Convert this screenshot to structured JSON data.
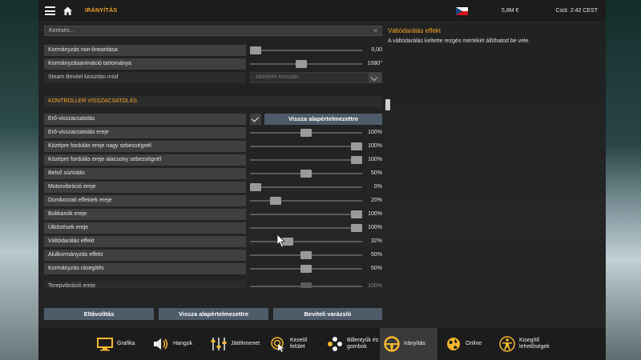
{
  "topbar": {
    "breadcrumb": "IRÁNYÍTÁS",
    "money": "5,8M  €",
    "clock": "Csüt. 2:42 CEST"
  },
  "search": {
    "placeholder": "Keresés..."
  },
  "settings": {
    "rows_top": [
      {
        "label": "Kormányzás non-linearitása",
        "value": "0,00",
        "level": 0.0
      },
      {
        "label": "Kormányzásanimáció tartománya",
        "value": "1080°",
        "level": 0.45
      }
    ],
    "steam": {
      "label": "Steam Bevitel kiosztási mód",
      "value": "Játékbeli kiosztás"
    },
    "section_title": "KONTROLLER VISSZACSATOLÁS",
    "ffb": {
      "label": "Erő-visszacsatolás",
      "checked": true,
      "reset_label": "Vissza alapértelmezettre"
    },
    "rows": [
      {
        "label": "Erő-visszacsatolás ereje",
        "value": "100%",
        "level": 0.5
      },
      {
        "label": "Középre fordulás ereje nagy sebességnél",
        "value": "100%",
        "level": 1.0
      },
      {
        "label": "Középre fordulás ereje alacsony sebességnél",
        "value": "100%",
        "level": 1.0
      },
      {
        "label": "Belső súrlódás",
        "value": "50%",
        "level": 0.5
      },
      {
        "label": "Motorvibráció ereje",
        "value": "0%",
        "level": 0.0
      },
      {
        "label": "Domborzati effektek ereje",
        "value": "20%",
        "level": 0.2
      },
      {
        "label": "Bukkanók ereje",
        "value": "100%",
        "level": 1.0
      },
      {
        "label": "Ütközések ereje",
        "value": "100%",
        "level": 1.0
      },
      {
        "label": "Váltódarálás effekt",
        "value": "32%",
        "level": 0.32
      },
      {
        "label": "Alulkormányzás effekt",
        "value": "50%",
        "level": 0.5
      },
      {
        "label": "Kormányzás rásegítés",
        "value": "50%",
        "level": 0.5
      },
      {
        "label": "Terepvibráció ereje",
        "value": "100%",
        "level": 0.5
      }
    ]
  },
  "info": {
    "title": "Váltódarálás effekt",
    "text": "A váltódarálás keltette rezgés mértékét állíthatod be vele."
  },
  "bottom_buttons": [
    "Eltávolítás",
    "Vissza alapértelmezettre",
    "Beviteli varázsló"
  ],
  "tabs": [
    {
      "name": "grafika",
      "label": "Grafika",
      "icon": "monitor-icon"
    },
    {
      "name": "hangok",
      "label": "Hangok",
      "icon": "speaker-icon"
    },
    {
      "name": "jatekmenet",
      "label": "Játékmenet",
      "icon": "sliders-icon"
    },
    {
      "name": "kezelofelulet",
      "label": "Kezelő\nfelület",
      "icon": "cursor-target-icon"
    },
    {
      "name": "billentyuk",
      "label": "Billentyűk és\ngombok",
      "icon": "gamepad-buttons-icon"
    },
    {
      "name": "iranyitas",
      "label": "Irányítás",
      "icon": "steering-wheel-icon",
      "active": true
    },
    {
      "name": "online",
      "label": "Online",
      "icon": "globe-icon"
    },
    {
      "name": "kisegito",
      "label": "Kisegítő\nlehetőségek",
      "icon": "accessibility-icon"
    }
  ],
  "colors": {
    "accent": "#f5a623",
    "button": "#4e5c69"
  }
}
